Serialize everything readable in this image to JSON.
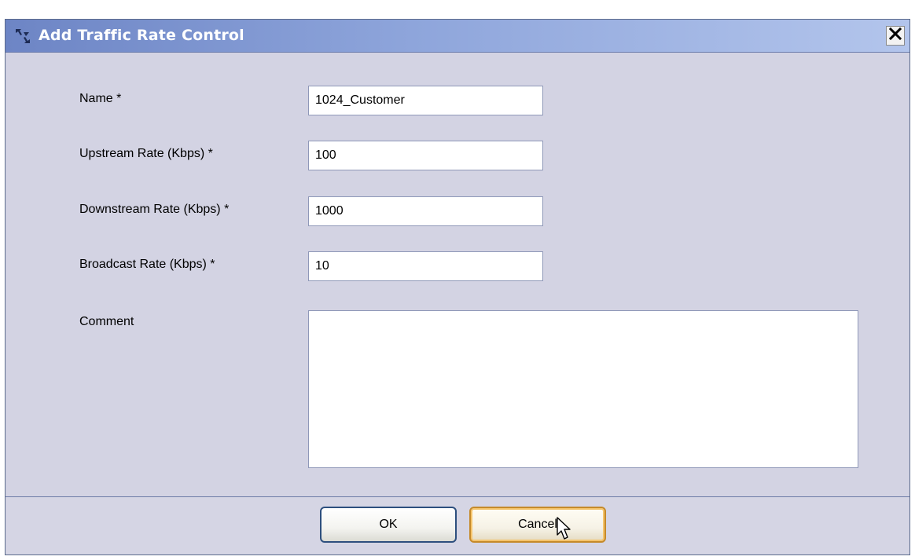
{
  "dialog": {
    "title": "Add Traffic Rate Control",
    "icon": "traffic-rate-icon",
    "close_icon": "close-icon"
  },
  "form": {
    "name": {
      "label": "Name  *",
      "value": "1024_Customer"
    },
    "upstream": {
      "label": "Upstream Rate (Kbps)  *",
      "value": "100"
    },
    "downstream": {
      "label": "Downstream Rate (Kbps)  *",
      "value": "1000"
    },
    "broadcast": {
      "label": "Broadcast Rate (Kbps)  *",
      "value": "10"
    },
    "comment": {
      "label": "Comment",
      "value": ""
    }
  },
  "buttons": {
    "ok_label": "OK",
    "cancel_label": "Cancel"
  },
  "colors": {
    "title_gradient_start": "#6d85c5",
    "title_gradient_end": "#b3c5ec",
    "panel_background": "#d3d3e3",
    "cancel_focus_border": "#c58a2a"
  }
}
